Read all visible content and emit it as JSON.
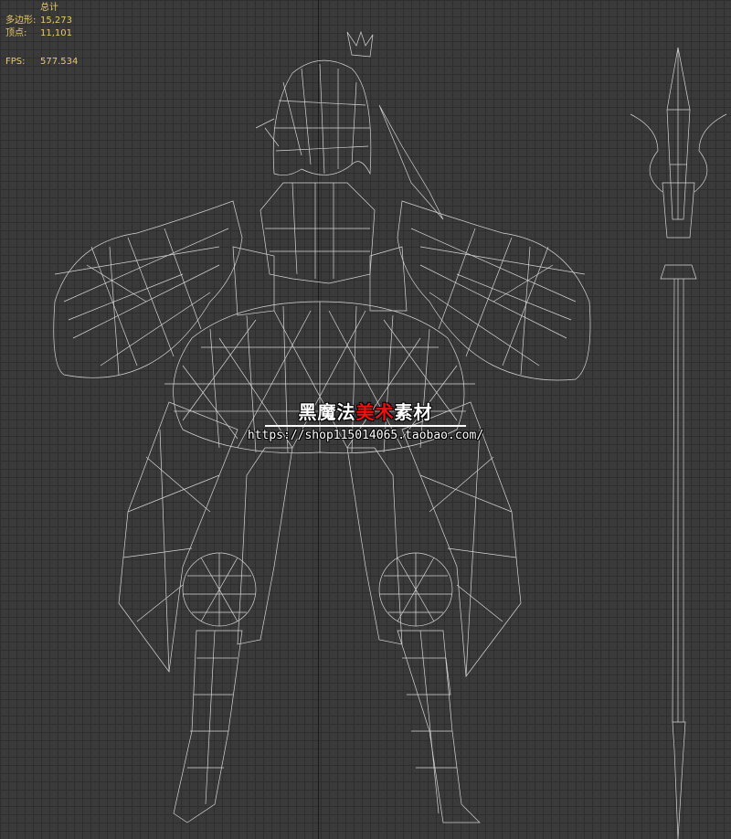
{
  "stats": {
    "title": "总计",
    "polygons_label": "多边形:",
    "polygons_value": "15,273",
    "vertices_label": "顶点:",
    "vertices_value": "11,101",
    "fps_label": "FPS:",
    "fps_value": "577.534"
  },
  "watermark": {
    "title_part1": "黑魔法",
    "title_accent": "美术",
    "title_part2": "素材",
    "url": "https://shop115014065.taobao.com/"
  },
  "colors": {
    "background": "#3a3a3a",
    "grid": "#2e2e2e",
    "wire": "#e6e6e6",
    "stats_text": "#e8c96a",
    "watermark_accent": "#ee1111"
  }
}
